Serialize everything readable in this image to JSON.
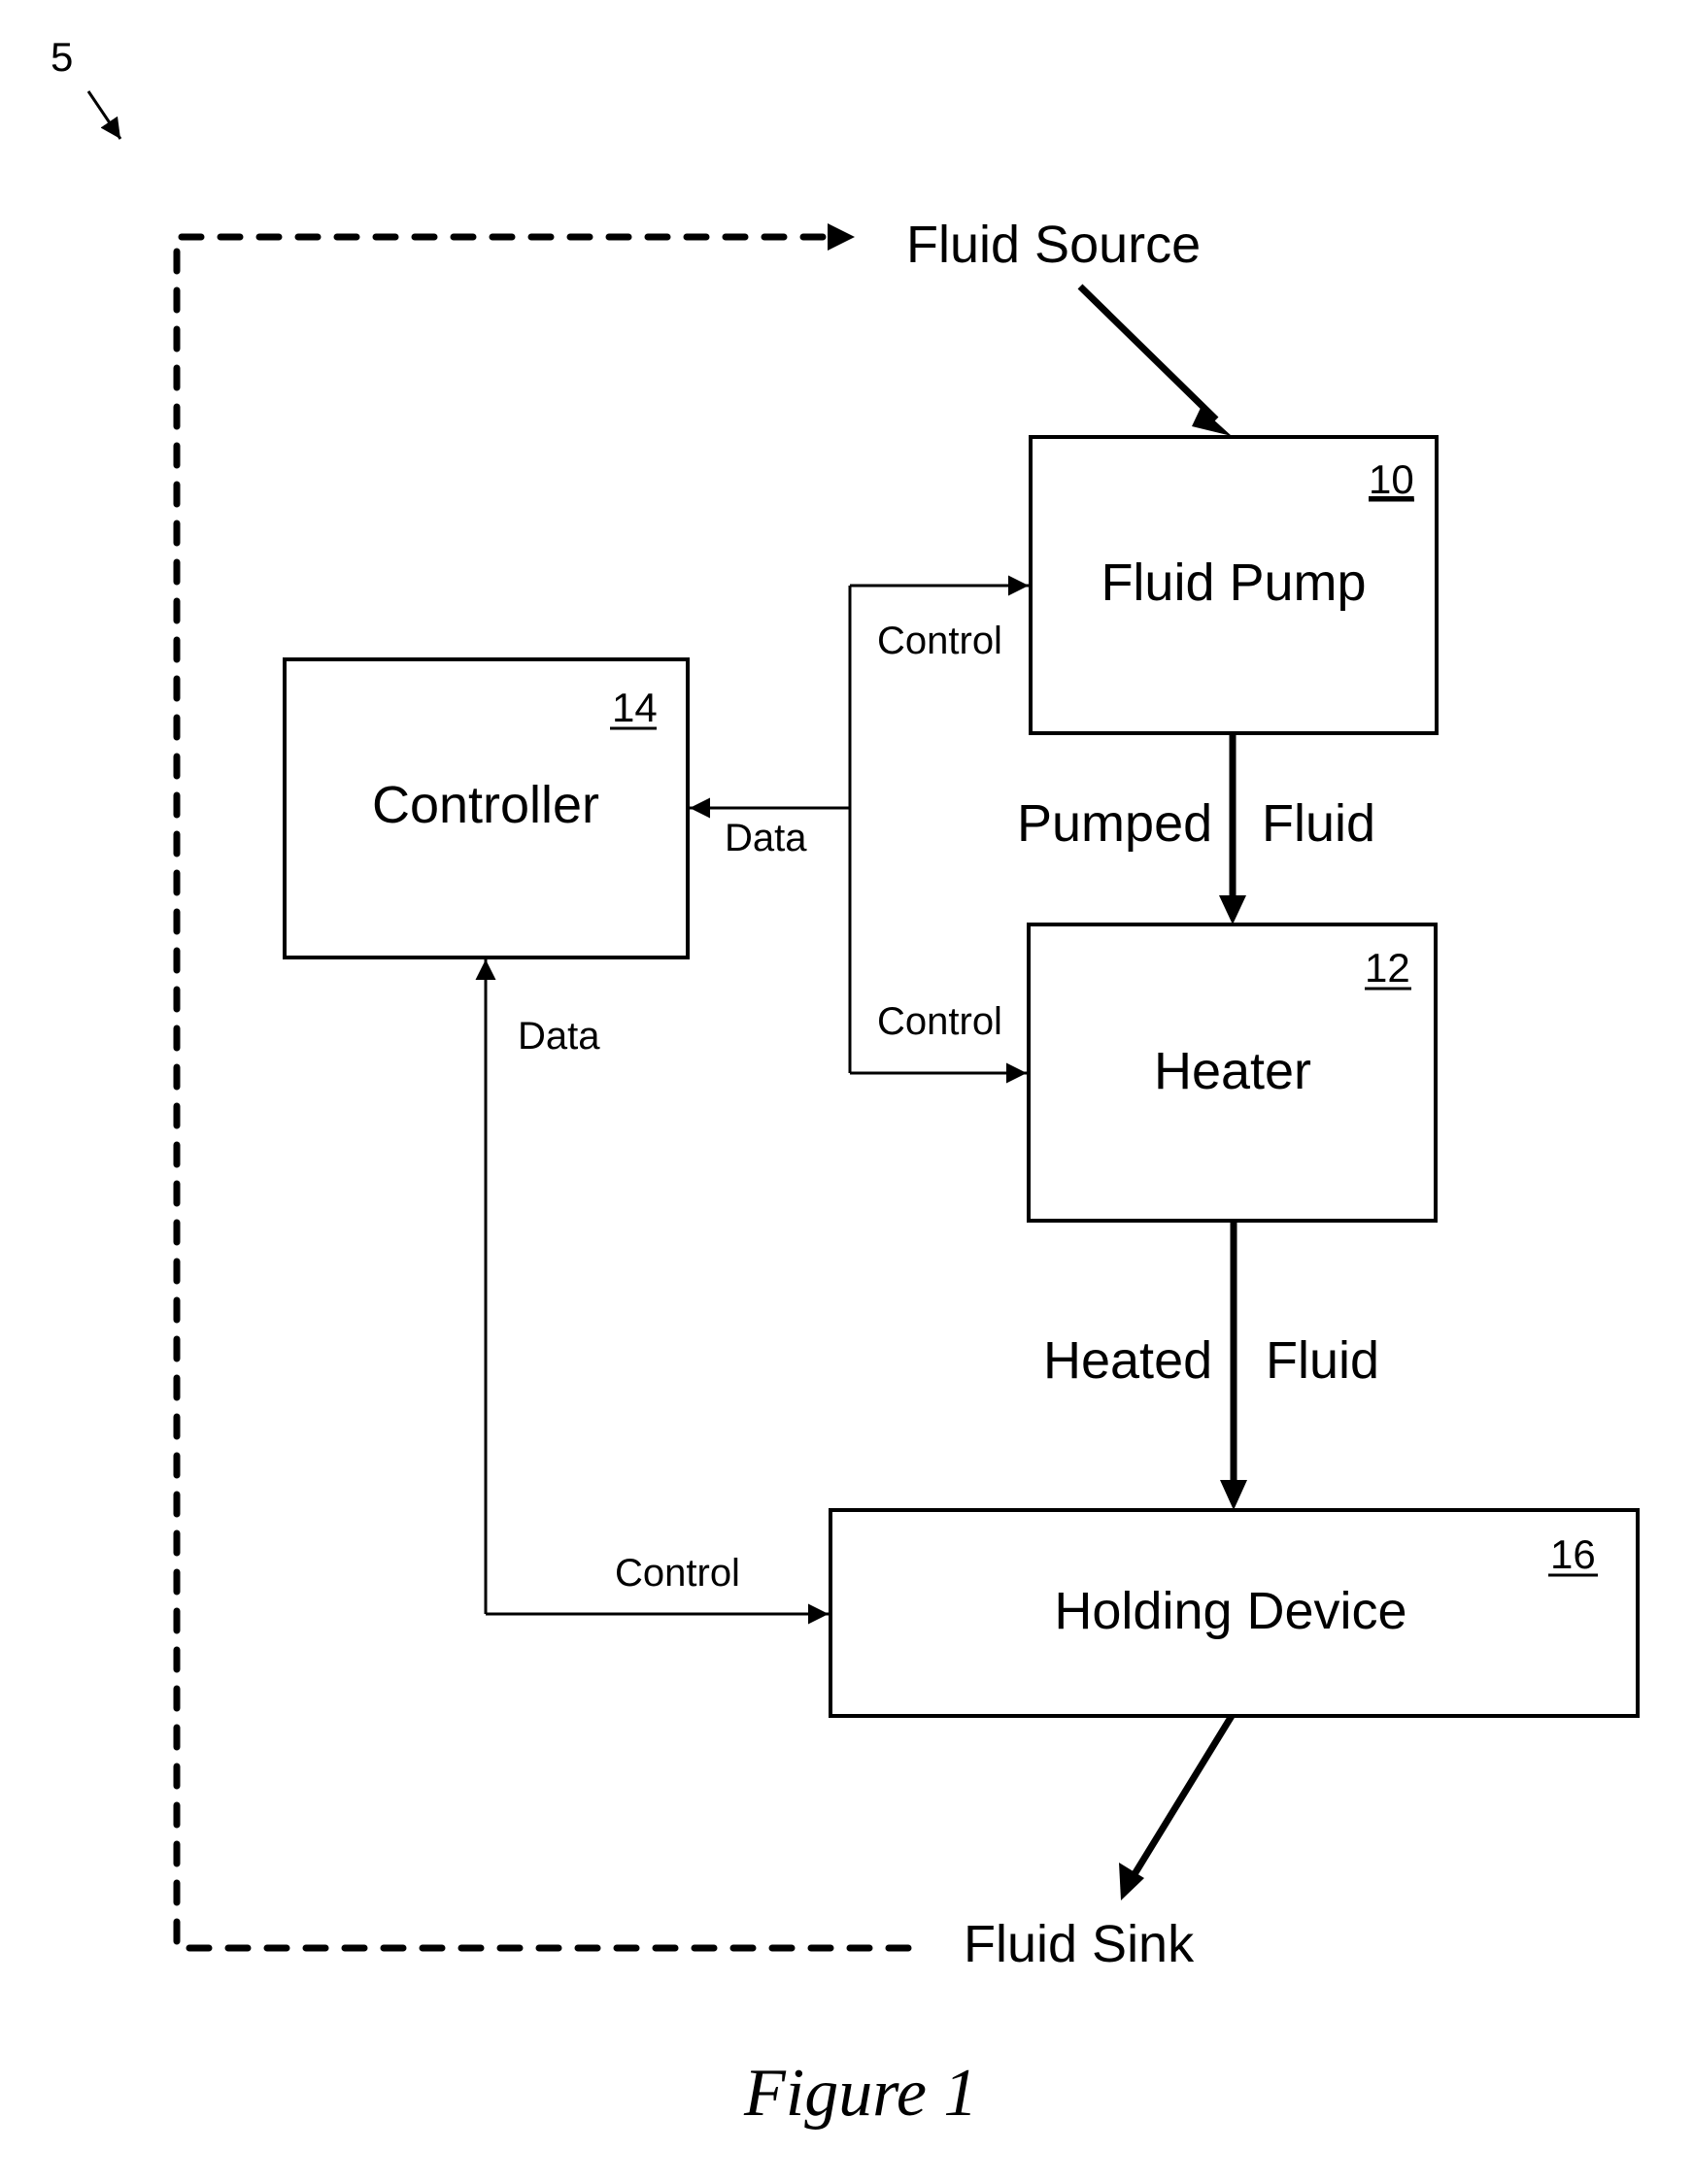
{
  "figure": {
    "reference_numeral": "5",
    "caption": "Figure 1"
  },
  "blocks": {
    "fluid_pump": {
      "label": "Fluid Pump",
      "ref": "10"
    },
    "heater": {
      "label": "Heater",
      "ref": "12"
    },
    "controller": {
      "label": "Controller",
      "ref": "14"
    },
    "holding_device": {
      "label": "Holding Device",
      "ref": "16"
    }
  },
  "terminals": {
    "source": "Fluid Source",
    "sink": "Fluid Sink"
  },
  "flows": {
    "pumped": {
      "left": "Pumped",
      "right": "Fluid"
    },
    "heated": {
      "left": "Heated",
      "right": "Fluid"
    }
  },
  "signals": {
    "control_pump": "Control",
    "data_to_controller": "Data",
    "control_heater": "Control",
    "data_from_holding": "Data",
    "control_holding": "Control"
  },
  "colors": {
    "ink": "#000000",
    "paper": "#ffffff"
  }
}
